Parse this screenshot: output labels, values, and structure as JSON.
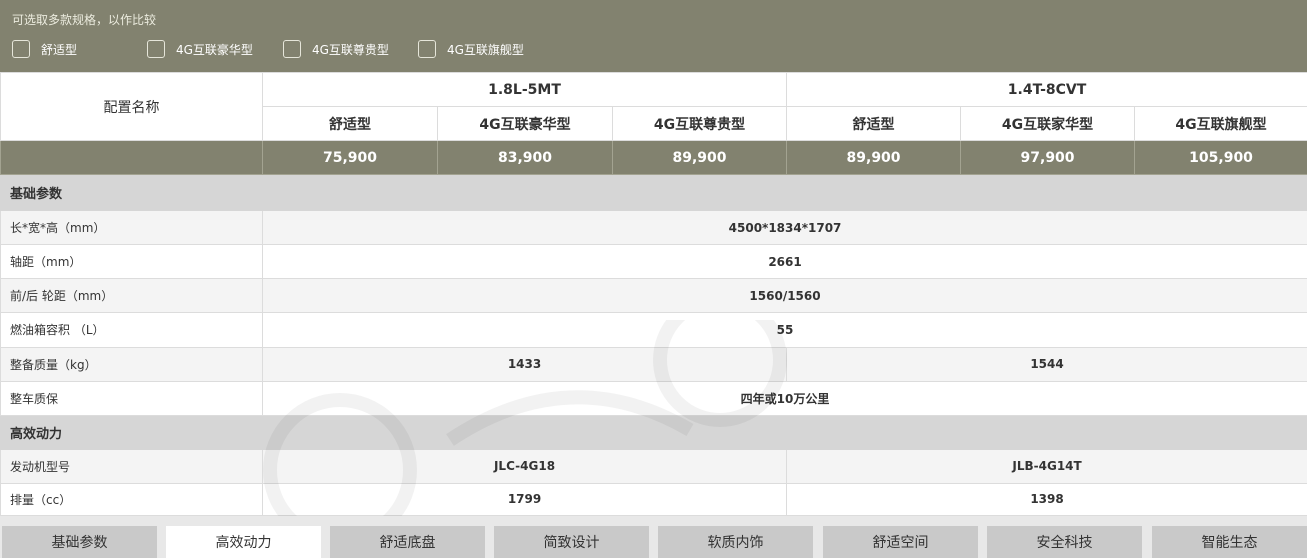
{
  "filter": {
    "hint": "可选取多款规格，以作比较",
    "options": [
      "舒适型",
      "4G互联豪华型",
      "4G互联尊贵型",
      "4G互联旗舰型"
    ]
  },
  "table": {
    "header_name": "配置名称",
    "groups": [
      "1.8L-5MT",
      "1.4T-8CVT"
    ],
    "trims": [
      "舒适型",
      "4G互联豪华型",
      "4G互联尊贵型",
      "舒适型",
      "4G互联家华型",
      "4G互联旗舰型"
    ],
    "prices": [
      "75,900",
      "83,900",
      "89,900",
      "89,900",
      "97,900",
      "105,900"
    ],
    "sections": {
      "basic": "基础参数",
      "power": "高效动力"
    },
    "rows": {
      "dims": {
        "label": "长*宽*高（mm）",
        "value": "4500*1834*1707"
      },
      "wheelbase": {
        "label": "轴距（mm）",
        "value": "2661"
      },
      "track": {
        "label": "前/后 轮距（mm）",
        "value": "1560/1560"
      },
      "fuel": {
        "label": "燃油箱容积 （L）",
        "value": "55"
      },
      "weight": {
        "label": "整备质量（kg）",
        "values": [
          "1433",
          "1544"
        ]
      },
      "warranty": {
        "label": "整车质保",
        "value": "四年或10万公里"
      },
      "engine": {
        "label": "发动机型号",
        "values": [
          "JLC-4G18",
          "JLB-4G14T"
        ]
      },
      "displacement": {
        "label": "排量（cc）",
        "values": [
          "1799",
          "1398"
        ]
      }
    }
  },
  "tabs": [
    "基础参数",
    "高效动力",
    "舒适底盘",
    "简致设计",
    "软质内饰",
    "舒适空间",
    "安全科技",
    "智能生态"
  ],
  "active_tab": "高效动力",
  "colors": {
    "accent": "#82826f",
    "section_bg": "#d6d6d6",
    "tab_inactive": "#c9c9c9"
  }
}
